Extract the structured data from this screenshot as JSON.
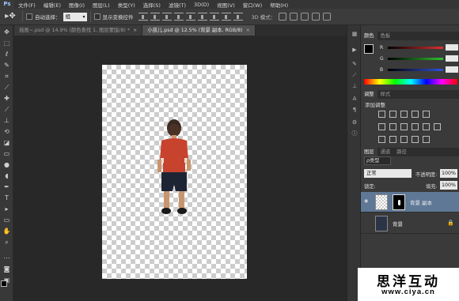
{
  "app": {
    "logo": "Ps"
  },
  "menu": [
    "文件(F)",
    "编辑(E)",
    "图像(I)",
    "图层(L)",
    "类型(Y)",
    "选择(S)",
    "滤镜(T)",
    "3D(D)",
    "视图(V)",
    "窗口(W)",
    "帮助(H)"
  ],
  "options_bar": {
    "tool_icon": "move-tool-icon",
    "auto_select_label": "自动选择：",
    "auto_select_value": "组",
    "show_transform_label": "显示变换控件",
    "mode_3d_label": "3D 模式："
  },
  "tabs": [
    {
      "label": "插画~.psd @ 14.9% (颜色查找 1, 图层蒙版/8) *",
      "active": false
    },
    {
      "label": "小孩儿.psd @ 12.5% (背景 副本, RGB/8)",
      "active": true
    }
  ],
  "color_panel": {
    "tabs": [
      "颜色",
      "色板"
    ],
    "channels": [
      "R",
      "G",
      "B"
    ],
    "colors": {
      "r": "#e03030",
      "g": "#30c030",
      "b": "#3050e0"
    }
  },
  "adjustments_panel": {
    "tabs": [
      "调整",
      "样式"
    ],
    "title": "添加调整"
  },
  "layers_panel": {
    "tabs": [
      "图层",
      "通道",
      "路径"
    ],
    "kind_filter": "ρ类型",
    "blend_mode": "正常",
    "opacity_label": "不透明度:",
    "opacity_value": "100%",
    "lock_label": "锁定:",
    "fill_label": "填充:",
    "fill_value": "100%",
    "layers": [
      {
        "name": "背景 副本",
        "selected": true,
        "visible": true
      },
      {
        "name": "背景",
        "selected": false,
        "visible": false
      }
    ]
  },
  "watermark": {
    "title": "思洋互动",
    "url": "www.ciya.cn"
  }
}
